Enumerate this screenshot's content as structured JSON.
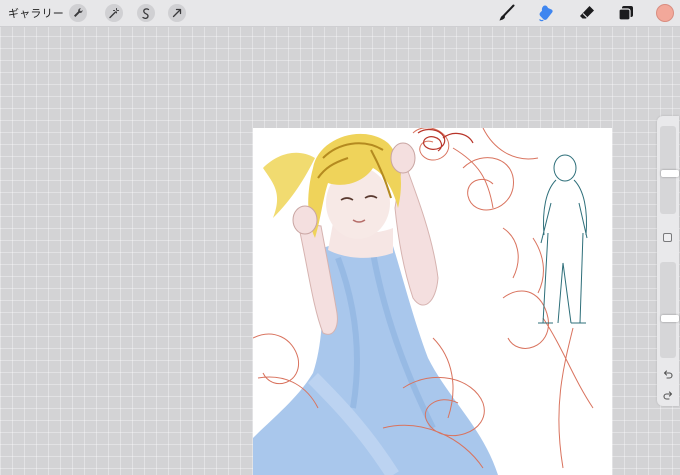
{
  "toolbar": {
    "gallery_label": "ギャラリー",
    "left_tools": [
      "wrench-icon",
      "magic-wand-icon",
      "selection-icon",
      "transform-arrow-icon"
    ],
    "right_tools": [
      "brush-icon",
      "smudge-icon",
      "eraser-icon",
      "layers-icon"
    ],
    "active_tool": "smudge-icon",
    "active_color": "#f2a89a"
  },
  "sidebar": {
    "brush_size": 0.15,
    "opacity": 0.4,
    "undo_icon": "undo-icon",
    "redo_icon": "redo-icon"
  }
}
